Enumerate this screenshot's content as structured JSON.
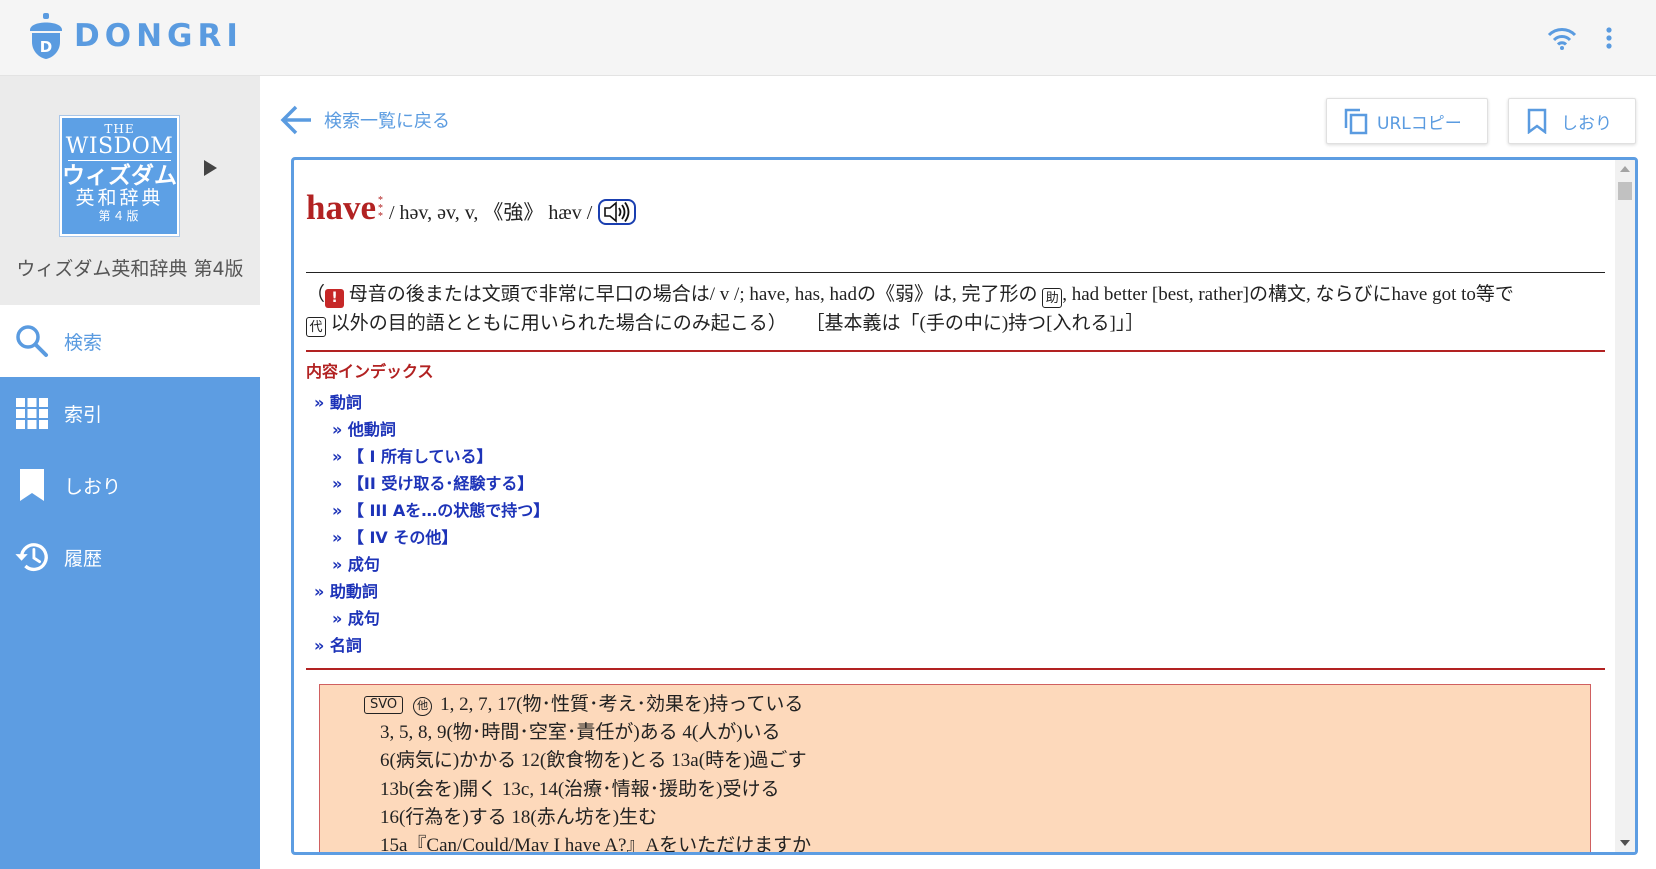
{
  "app": {
    "logo_text": "DONGRI",
    "logo_letter": "D"
  },
  "book": {
    "cover_the": "THE",
    "cover_wisdom": "WISDOM",
    "cover_ja1": "ウィズダム",
    "cover_ja2": "英和辞典",
    "cover_edition": "第４版",
    "title": "ウィズダム英和辞典 第4版"
  },
  "nav": {
    "search": "検索",
    "index": "索引",
    "bookmark": "しおり",
    "history": "履歴"
  },
  "toolbar": {
    "back": "検索一覧に戻る",
    "url_copy": "URLコピー",
    "bookmark": "しおり"
  },
  "entry": {
    "headword": "have",
    "pron": "/ həv, əv, v, 《強》 hæv /",
    "note": {
      "open": "（",
      "badge_bang": "!",
      "p1": "母音の後または文頭で非常に早口の場合は/ v /; have, has, hadの《弱》は, 完了形の",
      "badge_aux": "助",
      "p2": ", had better [best, rather]の構文, ならびにhave got to等で",
      "badge_pro": "代",
      "p3": "以外の目的語とともに用いられた場合にのみ起こる）",
      "basic": "［基本義は「(手の中に)持つ[入れる]」］"
    },
    "index_title": "内容インデックス",
    "index_items": [
      {
        "label": "» 動詞",
        "level": 1
      },
      {
        "label": "» 他動詞",
        "level": 2
      },
      {
        "label": "» 【 I 所有している】",
        "level": 2
      },
      {
        "label": "» 【II 受け取る･経験する】",
        "level": 2
      },
      {
        "label": "» 【 III Aを…の状態で持つ】",
        "level": 2
      },
      {
        "label": "» 【 IV その他】",
        "level": 2
      },
      {
        "label": "» 成句",
        "level": 2
      },
      {
        "label": "» 助動詞",
        "level": 1
      },
      {
        "label": "» 成句",
        "level": 2
      },
      {
        "label": "» 名詞",
        "level": 1
      }
    ],
    "svo": {
      "tag": "SVO",
      "circ": "他",
      "lines": [
        "1, 2, 7, 17(物･性質･考え･効果を)持っている",
        "3, 5, 8, 9(物･時間･空室･責任が)ある 4(人が)いる",
        "6(病気に)かかる 12(飲食物を)とる 13a(時を)過ごす",
        "13b(会を)開く 13c, 14(治療･情報･援助を)受ける",
        "16(行為を)する 18(赤ん坊を)生む",
        "15a『Can/Could/May I have A?』Aをいただけますか"
      ]
    }
  },
  "colors": {
    "accent": "#5d9de2",
    "headword": "#b22222",
    "link": "#1d33b8",
    "svo_bg": "#fdd9bb"
  }
}
